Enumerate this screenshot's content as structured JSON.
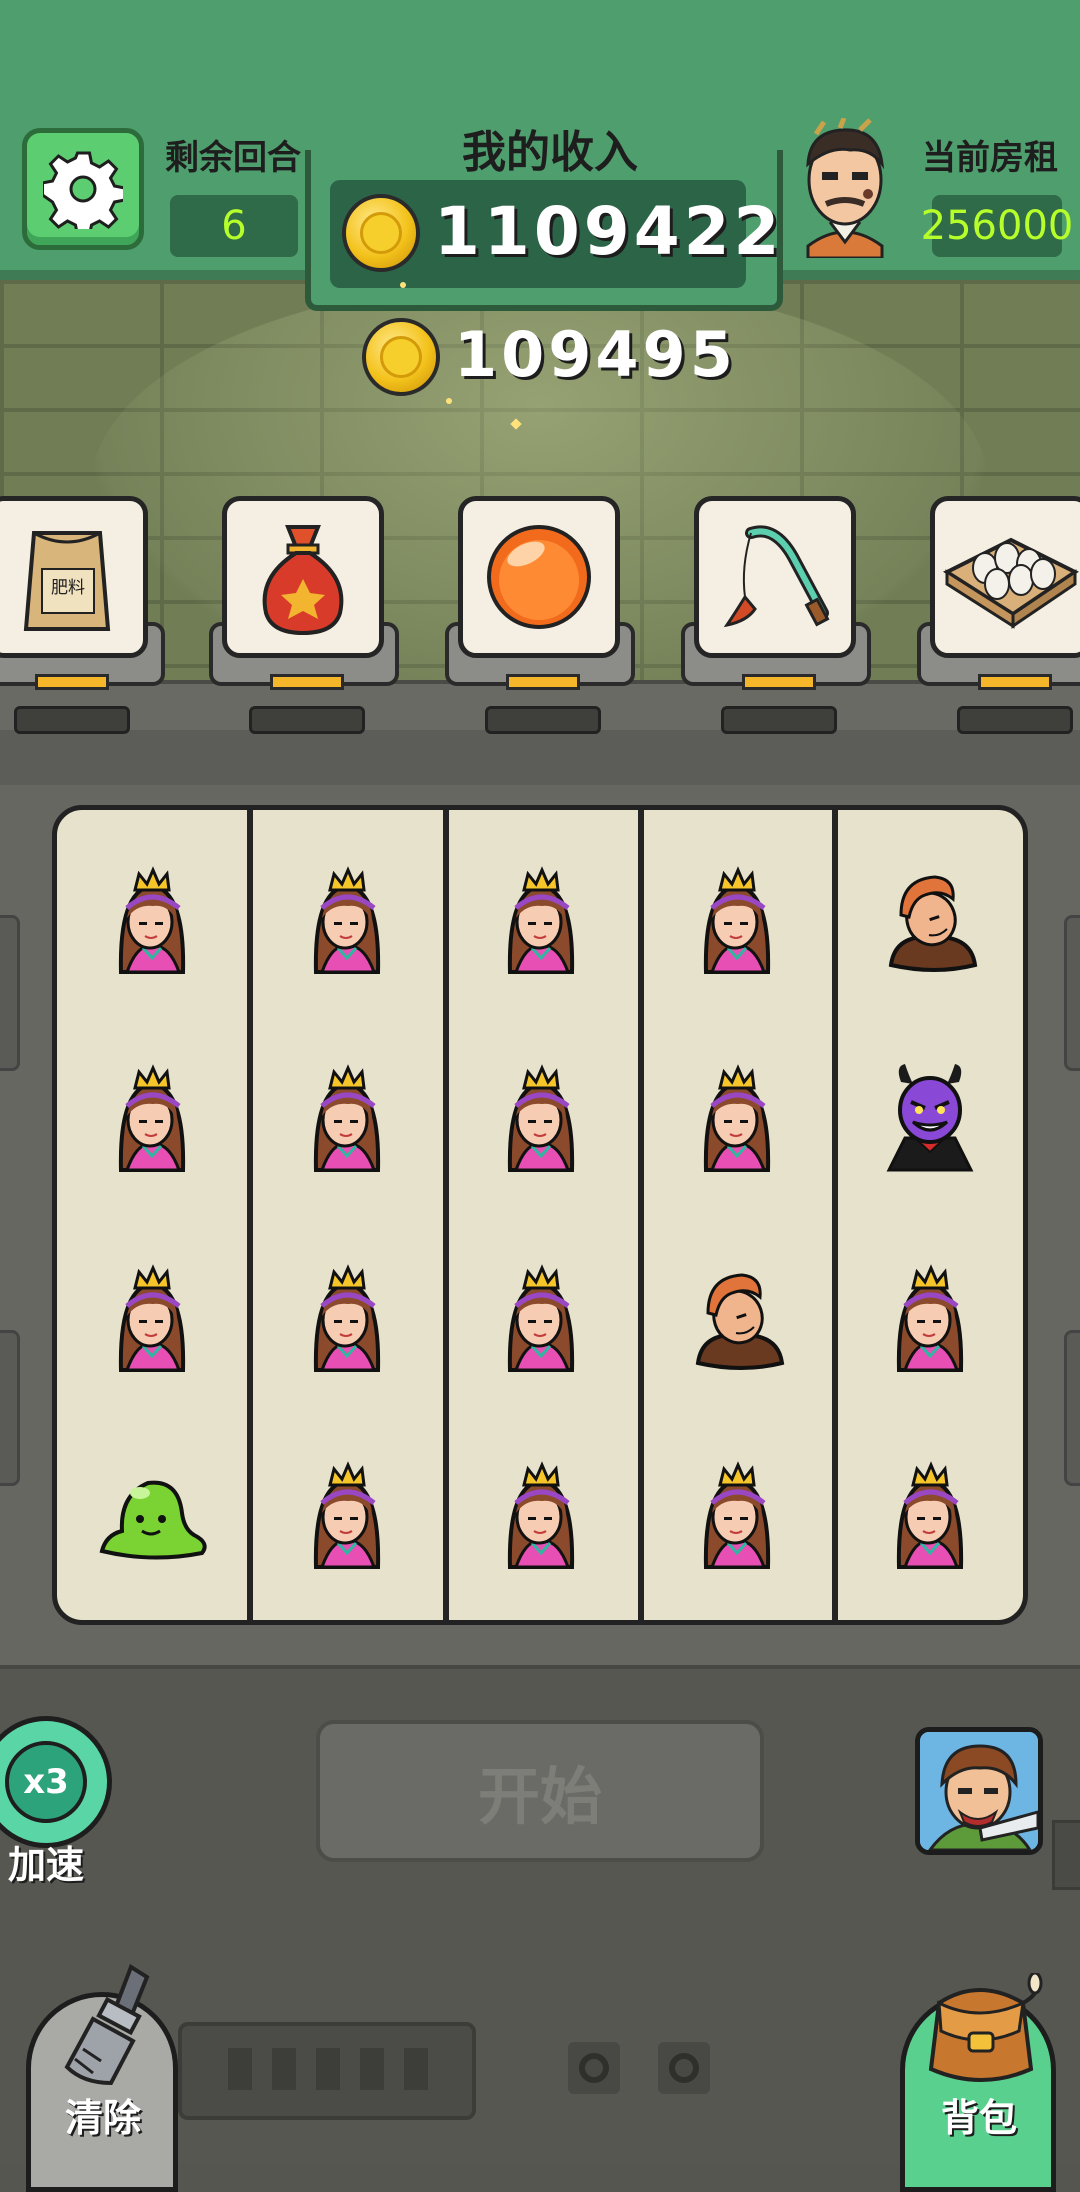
{
  "header": {
    "settings_icon": "gear-icon",
    "rounds_label": "剩余回合",
    "rounds_value": "6",
    "income_label": "我的收入",
    "income_value": "1109422",
    "bonus_value": "109495",
    "rent_label": "当前房租",
    "rent_value": "256000"
  },
  "items": [
    {
      "name": "fertilizer-bag",
      "text": "肥料"
    },
    {
      "name": "lucky-bag"
    },
    {
      "name": "orange-orb"
    },
    {
      "name": "fishing-rod"
    },
    {
      "name": "egg-tray"
    }
  ],
  "board": {
    "columns": [
      [
        "princess",
        "princess",
        "princess",
        "slime"
      ],
      [
        "princess",
        "princess",
        "princess",
        "princess"
      ],
      [
        "princess",
        "princess",
        "princess",
        "princess"
      ],
      [
        "princess",
        "princess",
        "bandit",
        "princess"
      ],
      [
        "bandit",
        "demon",
        "princess",
        "princess"
      ]
    ]
  },
  "controls": {
    "start_label": "开始",
    "speed_badge": "x3",
    "speed_label": "加速",
    "clear_label": "清除",
    "bag_label": "背包"
  },
  "colors": {
    "header_green": "#4f9e6d",
    "value_lime": "#b6ff2a",
    "board_bg": "#e6e2cb",
    "princess_dress": "#e84fb4"
  }
}
